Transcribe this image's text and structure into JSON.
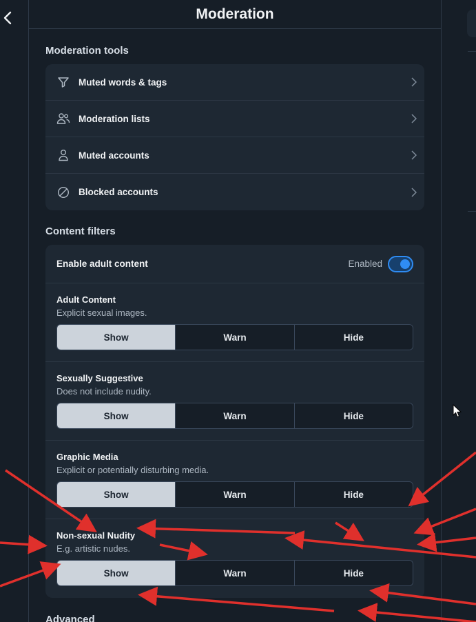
{
  "header": {
    "title": "Moderation",
    "back_icon": "chevron-left-icon"
  },
  "moderation_tools": {
    "section_title": "Moderation tools",
    "items": [
      {
        "label": "Muted words & tags",
        "icon": "filter-icon"
      },
      {
        "label": "Moderation lists",
        "icon": "users-icon"
      },
      {
        "label": "Muted accounts",
        "icon": "person-icon"
      },
      {
        "label": "Blocked accounts",
        "icon": "blocked-icon"
      }
    ]
  },
  "content_filters": {
    "section_title": "Content filters",
    "adult_toggle": {
      "label": "Enable adult content",
      "status": "Enabled",
      "on": true
    },
    "filters": [
      {
        "title": "Adult Content",
        "description": "Explicit sexual images.",
        "selected": "Show"
      },
      {
        "title": "Sexually Suggestive",
        "description": "Does not include nudity.",
        "selected": "Show"
      },
      {
        "title": "Graphic Media",
        "description": "Explicit or potentially disturbing media.",
        "selected": "Show"
      },
      {
        "title": "Non-sexual Nudity",
        "description": "E.g. artistic nudes.",
        "selected": "Show"
      }
    ],
    "options": {
      "show": "Show",
      "warn": "Warn",
      "hide": "Hide"
    }
  },
  "advanced": {
    "section_title": "Advanced"
  },
  "colors": {
    "background": "#161e27",
    "card": "#1e2833",
    "accent": "#2f8cf3",
    "annotation": "#e0302c"
  }
}
